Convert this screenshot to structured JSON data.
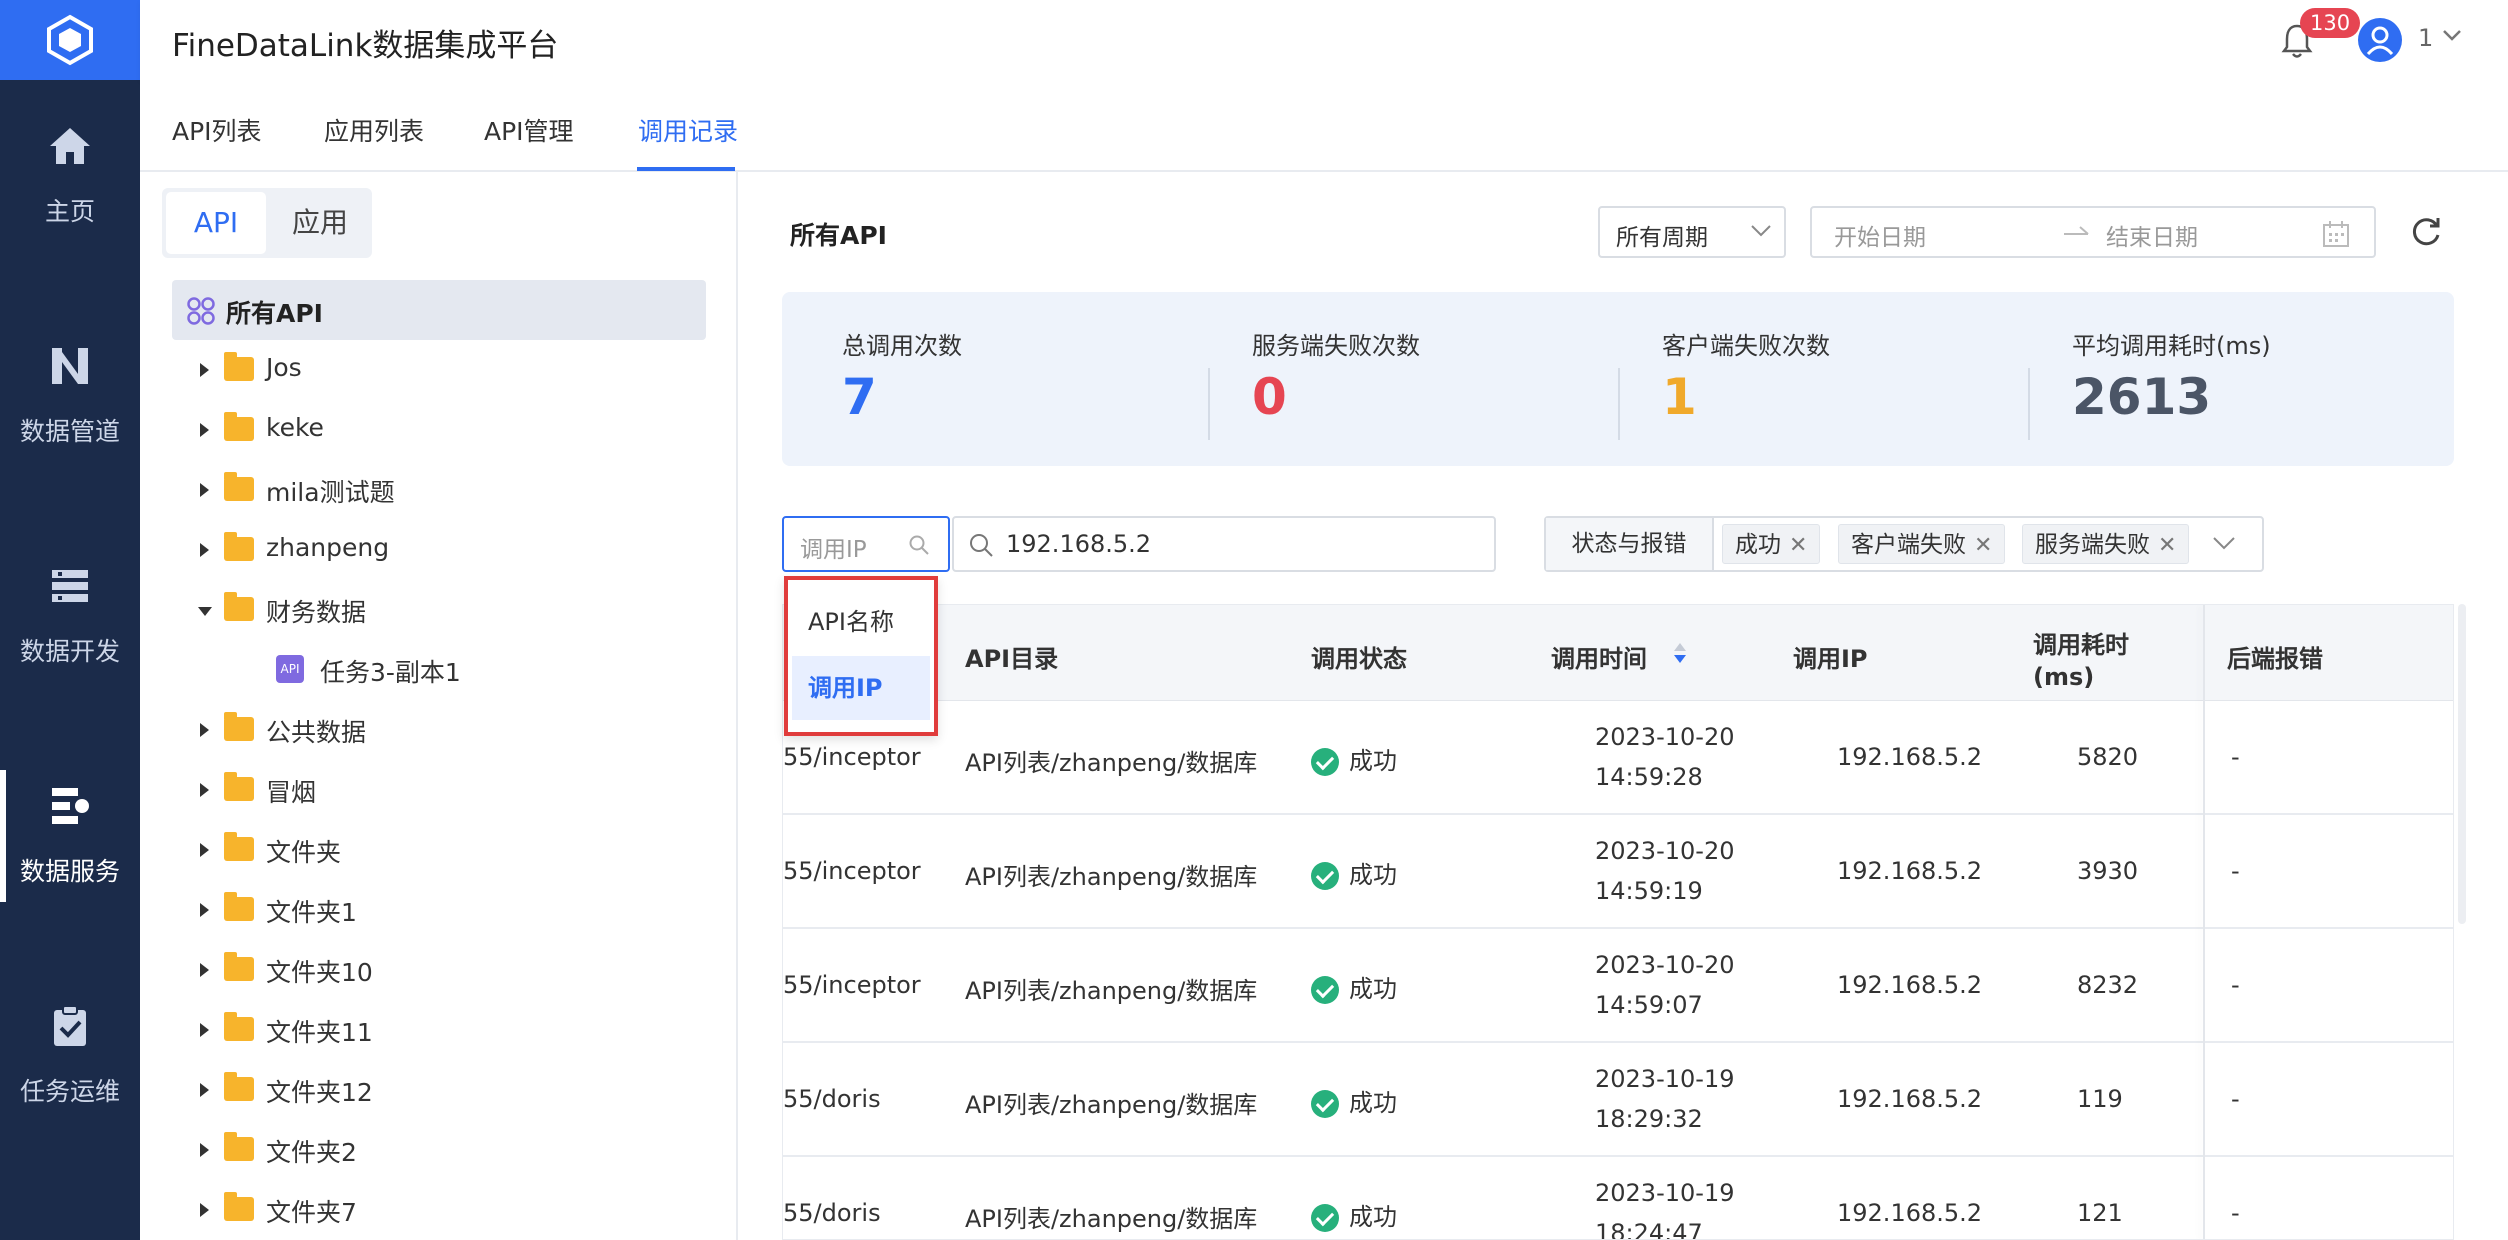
{
  "app": {
    "title": "FineDataLink数据集成平台",
    "notification_count": "130",
    "user_name": "1"
  },
  "nav": {
    "items": [
      {
        "label": "主页",
        "icon": "home-icon"
      },
      {
        "label": "数据管道",
        "icon": "pipeline-icon"
      },
      {
        "label": "数据开发",
        "icon": "dev-icon"
      },
      {
        "label": "数据服务",
        "icon": "service-icon",
        "active": true
      },
      {
        "label": "任务运维",
        "icon": "ops-icon"
      }
    ]
  },
  "tabs": [
    {
      "label": "API列表"
    },
    {
      "label": "应用列表"
    },
    {
      "label": "API管理"
    },
    {
      "label": "调用记录",
      "active": true
    }
  ],
  "tree": {
    "segment": {
      "api": "API",
      "app": "应用",
      "active": "API"
    },
    "all_label": "所有API",
    "nodes": [
      {
        "label": "Jos",
        "type": "folder",
        "expanded": false
      },
      {
        "label": "keke",
        "type": "folder",
        "expanded": false
      },
      {
        "label": "mila测试题",
        "type": "folder",
        "expanded": false
      },
      {
        "label": "zhanpeng",
        "type": "folder",
        "expanded": false
      },
      {
        "label": "财务数据",
        "type": "folder",
        "expanded": true
      },
      {
        "label": "任务3-副本1",
        "type": "api"
      },
      {
        "label": "公共数据",
        "type": "folder",
        "expanded": false
      },
      {
        "label": "冒烟",
        "type": "folder",
        "expanded": false
      },
      {
        "label": "文件夹",
        "type": "folder",
        "expanded": false
      },
      {
        "label": "文件夹1",
        "type": "folder",
        "expanded": false
      },
      {
        "label": "文件夹10",
        "type": "folder",
        "expanded": false
      },
      {
        "label": "文件夹11",
        "type": "folder",
        "expanded": false
      },
      {
        "label": "文件夹12",
        "type": "folder",
        "expanded": false
      },
      {
        "label": "文件夹2",
        "type": "folder",
        "expanded": false
      },
      {
        "label": "文件夹7",
        "type": "folder",
        "expanded": false
      }
    ],
    "api_badge": "API"
  },
  "main": {
    "title": "所有API",
    "period": "所有周期",
    "start_date_placeholder": "开始日期",
    "end_date_placeholder": "结束日期"
  },
  "stats": [
    {
      "label": "总调用次数",
      "value": "7",
      "color": "#2f6df2"
    },
    {
      "label": "服务端失败次数",
      "value": "0",
      "color": "#e64552"
    },
    {
      "label": "客户端失败次数",
      "value": "1",
      "color": "#f0a92b"
    },
    {
      "label": "平均调用耗时(ms)",
      "value": "2613",
      "color": "#4b5566"
    }
  ],
  "filter": {
    "field_placeholder": "调用IP",
    "search_value": "192.168.5.2",
    "status_label": "状态与报错",
    "status_tags": [
      "成功",
      "客户端失败",
      "服务端失败"
    ]
  },
  "dropdown": {
    "options": [
      {
        "label": "API名称",
        "selected": false
      },
      {
        "label": "调用IP",
        "selected": true
      }
    ]
  },
  "table": {
    "headers": [
      "API目录",
      "调用状态",
      "调用时间",
      "调用IP",
      "调用耗时",
      "(ms)",
      "后端报错"
    ],
    "rows": [
      {
        "path": "55/inceptor",
        "dir": "API列表/zhanpeng/数据库",
        "status": "成功",
        "date": "2023-10-20",
        "time": "14:59:28",
        "ip": "192.168.5.2",
        "ms": "5820",
        "error": "-"
      },
      {
        "path": "55/inceptor",
        "dir": "API列表/zhanpeng/数据库",
        "status": "成功",
        "date": "2023-10-20",
        "time": "14:59:19",
        "ip": "192.168.5.2",
        "ms": "3930",
        "error": "-"
      },
      {
        "path": "55/inceptor",
        "dir": "API列表/zhanpeng/数据库",
        "status": "成功",
        "date": "2023-10-20",
        "time": "14:59:07",
        "ip": "192.168.5.2",
        "ms": "8232",
        "error": "-"
      },
      {
        "path": "55/doris",
        "dir": "API列表/zhanpeng/数据库",
        "status": "成功",
        "date": "2023-10-19",
        "time": "18:29:32",
        "ip": "192.168.5.2",
        "ms": "119",
        "error": "-"
      },
      {
        "path": "55/doris",
        "dir": "API列表/zhanpeng/数据库",
        "status": "成功",
        "date": "2023-10-19",
        "time": "18:24:47",
        "ip": "192.168.5.2",
        "ms": "121",
        "error": "-"
      }
    ]
  },
  "colors": {
    "accent": "#2f6df2",
    "nav_bg": "#1b2b4a",
    "success": "#27b07c",
    "highlight_border": "#e03c3c"
  }
}
